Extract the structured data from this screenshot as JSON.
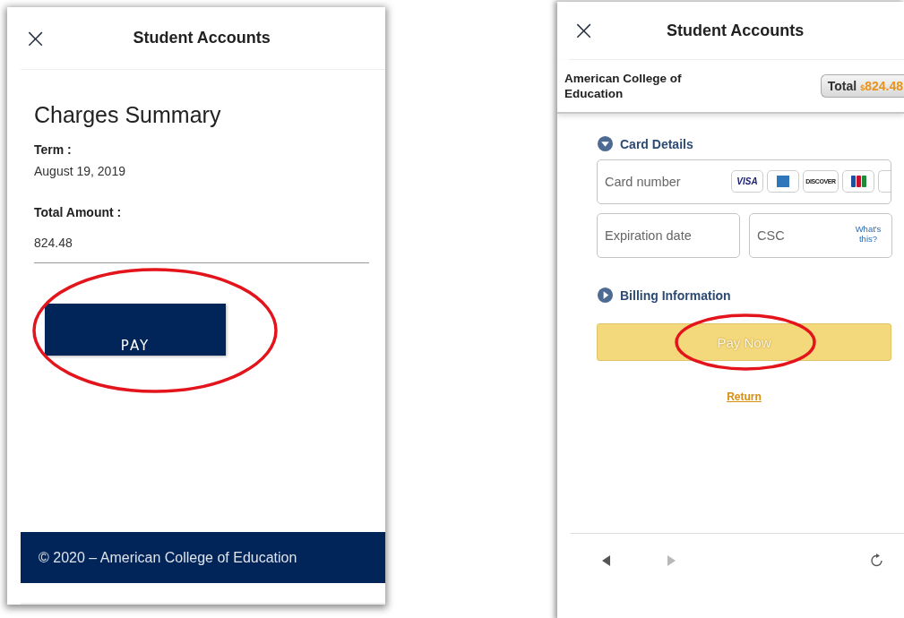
{
  "left_screen": {
    "header": {
      "close": "×",
      "title": "Student Accounts"
    },
    "heading": "Charges Summary",
    "fields": [
      {
        "label": "Term :",
        "value": "August 19, 2019"
      },
      {
        "label": "Total Amount :",
        "value": "824.48"
      }
    ],
    "pay_button": "PAY",
    "pay_highlighted": true,
    "footer": "© 2020 – American College of Education"
  },
  "right_screen": {
    "header": {
      "close": "×",
      "title": "Student Accounts"
    },
    "merchant": "American College of Education",
    "total": {
      "label": "Total",
      "currency": "$",
      "amount": "824.48"
    },
    "sections": [
      {
        "title": "Card Details",
        "expanded": true
      },
      {
        "title": "Billing Information",
        "expanded": false
      }
    ],
    "card_number": {
      "placeholder": "Card number"
    },
    "card_logos": [
      {
        "kind": "text",
        "label": "VISA"
      },
      {
        "kind": "amex"
      },
      {
        "kind": "text",
        "label": "DISCOVER"
      },
      {
        "kind": "jcb"
      },
      {
        "kind": "blank"
      }
    ],
    "expiration": {
      "placeholder": "Expiration date"
    },
    "csc": {
      "placeholder": "CSC",
      "help_link": "What's this?"
    },
    "pay_button": "Pay Now",
    "pay_highlighted": true,
    "return_link": "Return",
    "nav": [
      {
        "kind": "back",
        "disabled": false
      },
      {
        "kind": "forward",
        "disabled": true
      },
      {
        "kind": "reload",
        "disabled": false
      }
    ]
  }
}
